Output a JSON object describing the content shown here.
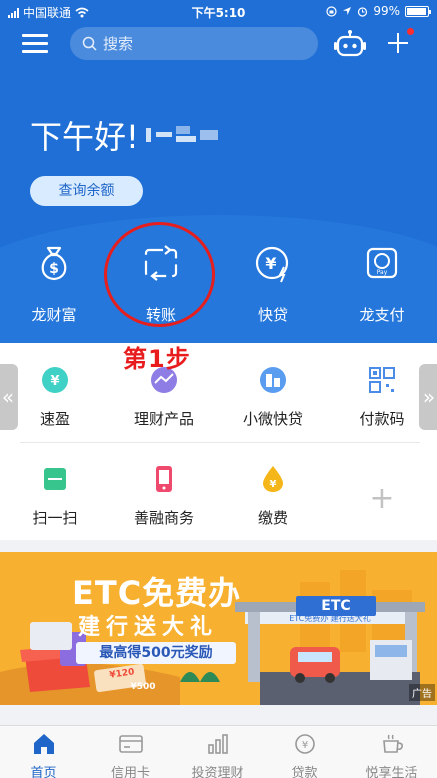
{
  "status_bar": {
    "carrier": "中国联通",
    "time": "下午5:10",
    "battery": "99%"
  },
  "header": {
    "search_placeholder": "搜索"
  },
  "greeting": "下午好!",
  "balance_button": "查询余额",
  "quick_actions": [
    {
      "label": "龙财富",
      "icon": "money-bag-icon"
    },
    {
      "label": "转账",
      "icon": "transfer-icon"
    },
    {
      "label": "快贷",
      "icon": "quick-loan-icon"
    },
    {
      "label": "龙支付",
      "icon": "long-pay-icon"
    }
  ],
  "annotation": {
    "label": "第1步",
    "color": "#e61e1e"
  },
  "services": [
    {
      "label": "速盈",
      "icon": "suying-icon"
    },
    {
      "label": "理财产品",
      "icon": "wealth-products-icon"
    },
    {
      "label": "小微快贷",
      "icon": "micro-loan-icon"
    },
    {
      "label": "付款码",
      "icon": "payment-code-icon"
    },
    {
      "label": "扫一扫",
      "icon": "scan-icon"
    },
    {
      "label": "善融商务",
      "icon": "shanrong-icon"
    },
    {
      "label": "缴费",
      "icon": "bill-pay-icon"
    }
  ],
  "banner": {
    "title": "ETC免费办",
    "subtitle": "建行送大礼",
    "award": "最高得500元奖励",
    "gate_label": "ETC",
    "gate_subtitle": "ETC免费办 建行送大礼",
    "ticket_text": "¥120",
    "coupon_text": "¥500",
    "ad_tag": "广告"
  },
  "tabbar": [
    {
      "label": "首页",
      "icon": "home-icon",
      "active": true
    },
    {
      "label": "信用卡",
      "icon": "credit-card-icon",
      "active": false
    },
    {
      "label": "投资理财",
      "icon": "investment-icon",
      "active": false
    },
    {
      "label": "贷款",
      "icon": "loan-icon",
      "active": false
    },
    {
      "label": "悦享生活",
      "icon": "coffee-icon",
      "active": false
    }
  ],
  "colors": {
    "brand_blue": "#1f6fd6",
    "accent_red": "#e61e1e",
    "banner_orange": "#f7b02f"
  }
}
